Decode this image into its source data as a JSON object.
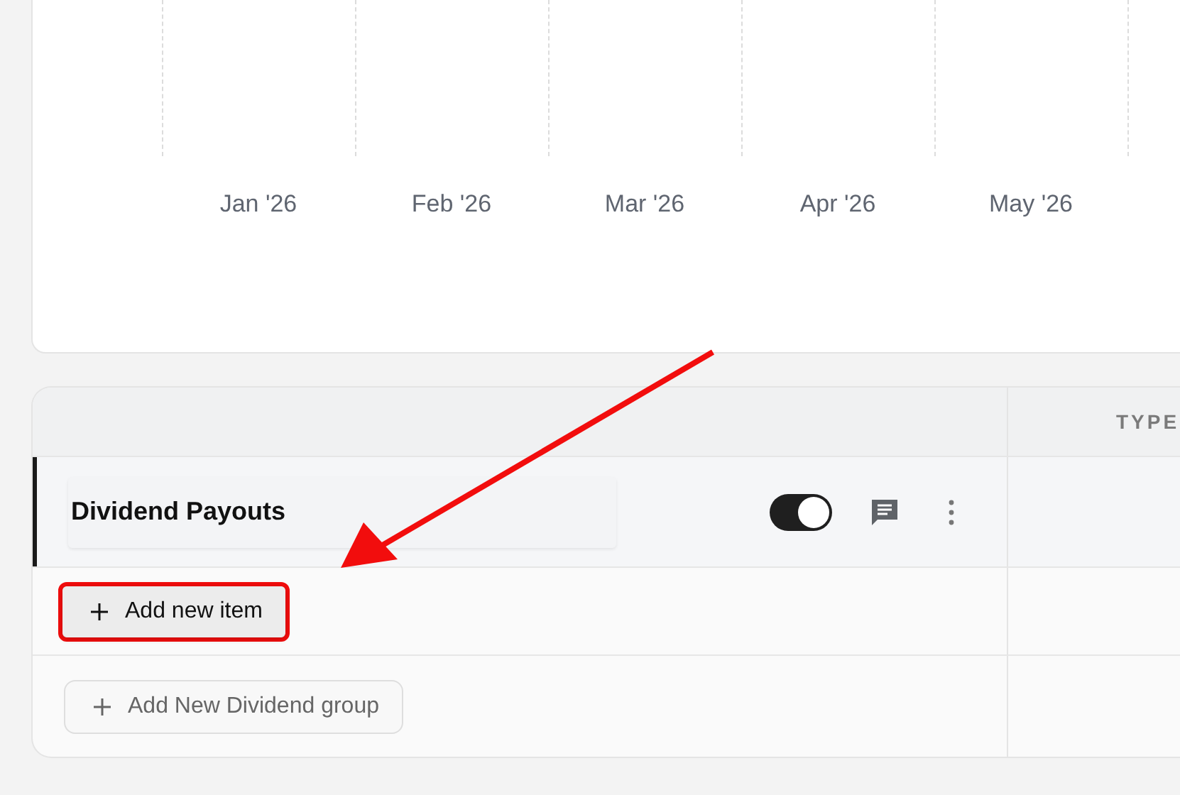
{
  "chart": {
    "month_labels": [
      "Jan '26",
      "Feb '26",
      "Mar '26",
      "Apr '26",
      "May '26"
    ]
  },
  "table": {
    "columns": [
      "",
      "TYPE"
    ],
    "groups": [
      {
        "name": "Dividend Payouts",
        "enabled": true,
        "add_item_label": "Add new item",
        "add_item_highlighted": true
      }
    ],
    "add_group_label": "Add New Dividend group"
  }
}
